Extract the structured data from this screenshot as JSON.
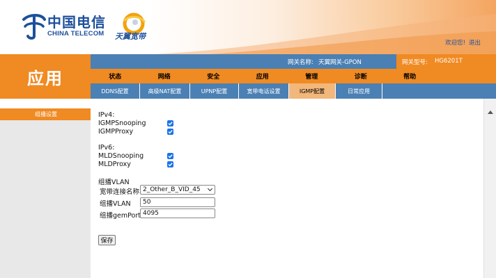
{
  "header": {
    "brand_cn": "中国电信",
    "brand_en": "CHINA TELECOM",
    "sub_brand": "天翼宽带",
    "links": [
      "欢迎您!",
      "退出"
    ]
  },
  "page_title": "应用",
  "info_bar": {
    "gateway_name_label": "网关名称:",
    "gateway_name_value": "天翼网关-GPON",
    "gateway_model_label": "网关型号:",
    "gateway_model_value": "HG6201T"
  },
  "main_nav": [
    "状态",
    "网络",
    "安全",
    "应用",
    "管理",
    "诊断",
    "帮助"
  ],
  "main_nav_active": "应用",
  "sub_nav": [
    {
      "label": "DDNS配置",
      "width": 71
    },
    {
      "label": "高级NAT配置",
      "width": 72
    },
    {
      "label": "UPNP配置",
      "width": 70
    },
    {
      "label": "宽带电话设置",
      "width": 72
    },
    {
      "label": "IGMP配置",
      "width": 67
    },
    {
      "label": "日常应用",
      "width": 67
    }
  ],
  "sub_nav_active": "IGMP配置",
  "sidebar": {
    "item": "组播设置"
  },
  "form": {
    "ipv4_heading": "IPv4:",
    "igmp_snooping_label": "IGMPSnooping",
    "igmp_proxy_label": "IGMPProxy",
    "ipv6_heading": "IPv6:",
    "mld_snooping_label": "MLDSnooping",
    "mld_proxy_label": "MLDProxy",
    "vlan_heading": "组播VLAN",
    "wan_name_label": "宽带连接名称",
    "wan_name_value": "2_Other_B_VID_45",
    "vlan_label": "组播VLAN",
    "vlan_value": "50",
    "gemport_label": "组播gemPort",
    "gemport_value": "4095",
    "save_label": "保存"
  },
  "colors": {
    "orange": "#f08a22",
    "blue": "#4b80b4",
    "checkbox": "#1a73e8"
  }
}
